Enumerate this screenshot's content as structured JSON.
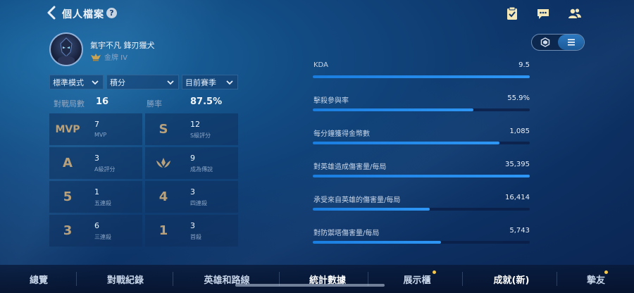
{
  "header": {
    "title": "個人檔案",
    "help_glyph": "?"
  },
  "profile": {
    "name": "氣宇不凡 鋒刃獵犬",
    "rank": "金牌 IV"
  },
  "filters": [
    {
      "label": "標準模式"
    },
    {
      "label": "積分"
    },
    {
      "label": "目前賽季"
    }
  ],
  "summary": {
    "matches_label": "對戰局數",
    "matches_value": "16",
    "winrate_label": "勝率",
    "winrate_value": "87.5%"
  },
  "stats": [
    {
      "glyph": "MVP",
      "value": "7",
      "label": "MVP"
    },
    {
      "glyph": "S",
      "value": "12",
      "label": "S級評分"
    },
    {
      "glyph": "A",
      "value": "3",
      "label": "A級評分"
    },
    {
      "glyph": "legend",
      "value": "9",
      "label": "成為傳說"
    },
    {
      "glyph": "5",
      "value": "1",
      "label": "五連殺"
    },
    {
      "glyph": "4",
      "value": "3",
      "label": "四連殺"
    },
    {
      "glyph": "3",
      "value": "6",
      "label": "三連殺"
    },
    {
      "glyph": "1",
      "value": "3",
      "label": "首殺"
    }
  ],
  "metrics": [
    {
      "label": "KDA",
      "value": "9.5",
      "fill": 1.0
    },
    {
      "label": "擊殺參與率",
      "value": "55.9%",
      "fill": 0.74
    },
    {
      "label": "每分鐘獲得金幣數",
      "value": "1,085",
      "fill": 0.86
    },
    {
      "label": "對英雄造成傷害量/每局",
      "value": "35,395",
      "fill": 1.0
    },
    {
      "label": "承受來自英雄的傷害量/每局",
      "value": "16,414",
      "fill": 0.54
    },
    {
      "label": "對防禦塔傷害量/每局",
      "value": "5,743",
      "fill": 0.59
    }
  ],
  "tabs": [
    {
      "label": "總覽"
    },
    {
      "label": "對戰紀錄"
    },
    {
      "label": "英雄和路線"
    },
    {
      "label": "統計數據"
    },
    {
      "label": "展示櫃"
    },
    {
      "label": "成就(新)"
    },
    {
      "label": "摯友"
    }
  ],
  "colors": {
    "accent": "#2e97f5",
    "gold": "#f5c84a"
  }
}
